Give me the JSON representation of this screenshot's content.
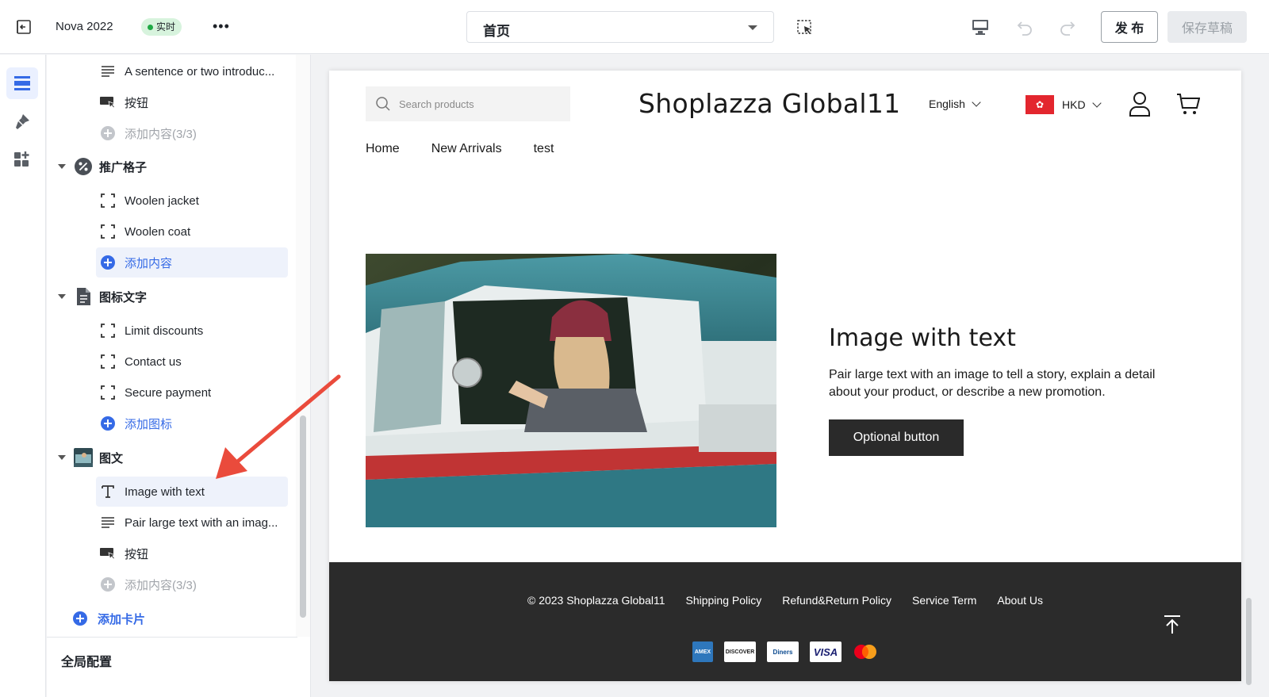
{
  "topbar": {
    "theme_name": "Nova 2022",
    "status_badge": "实时",
    "more": "•••",
    "page_selector": "首页",
    "publish": "发 布",
    "save_draft": "保存草稿"
  },
  "sidebar": {
    "rows": [
      {
        "label": "A sentence or two introduc...",
        "icon": "text-lines-icon"
      },
      {
        "label": "按钮",
        "icon": "button-icon"
      },
      {
        "label": "添加内容(3/3)",
        "icon": "add-circle-icon"
      },
      {
        "label": "Woolen jacket",
        "icon": "block-frame-icon"
      },
      {
        "label": "Woolen coat",
        "icon": "block-frame-icon"
      },
      {
        "label": "添加内容",
        "icon": "add-circle-icon"
      },
      {
        "label": "Limit discounts",
        "icon": "block-frame-icon"
      },
      {
        "label": "Contact us",
        "icon": "block-frame-icon"
      },
      {
        "label": "Secure payment",
        "icon": "block-frame-icon"
      },
      {
        "label": "添加图标",
        "icon": "add-circle-icon"
      },
      {
        "label": "Image with text",
        "icon": "text-t-icon"
      },
      {
        "label": "Pair large text with an imag...",
        "icon": "text-lines-icon"
      },
      {
        "label": "按钮",
        "icon": "button-icon"
      },
      {
        "label": "添加内容(3/3)",
        "icon": "add-circle-icon"
      }
    ],
    "sections": [
      {
        "label": "推广格子",
        "icon": "percent-badge-icon"
      },
      {
        "label": "图标文字",
        "icon": "document-icon"
      },
      {
        "label": "图文",
        "icon": "image-thumb-icon"
      }
    ],
    "add_card": "添加卡片",
    "global_config": "全局配置"
  },
  "store": {
    "search_placeholder": "Search products",
    "title": "Shoplazza Global11",
    "language": "English",
    "currency": "HKD",
    "flag_symbol": "✿",
    "nav": [
      "Home",
      "New Arrivals",
      "test"
    ],
    "section": {
      "title": "Image with text",
      "description": "Pair large text with an image to tell a story, explain a detail about your product, or describe a new promotion.",
      "button": "Optional button"
    },
    "footer": {
      "copyright": "© 2023 Shoplazza Global11",
      "links": [
        "Shipping Policy",
        "Refund&Return Policy",
        "Service Term",
        "About Us"
      ],
      "payments": [
        {
          "name": "AMEX",
          "bg": "#2e77bc",
          "fg": "#ffffff"
        },
        {
          "name": "DISCOVER",
          "bg": "#ffffff",
          "fg": "#1a1a1a"
        },
        {
          "name": "Diners",
          "bg": "#ffffff",
          "fg": "#0b4a8f"
        },
        {
          "name": "VISA",
          "bg": "#ffffff",
          "fg": "#1a1f71"
        },
        {
          "name": "",
          "bg": "#2b2b2b",
          "fg": "#ffffff"
        }
      ]
    }
  },
  "colors": {
    "accent_blue": "#356ae6",
    "live_green": "#1fa945",
    "annotation_red": "#ea4b3c"
  }
}
